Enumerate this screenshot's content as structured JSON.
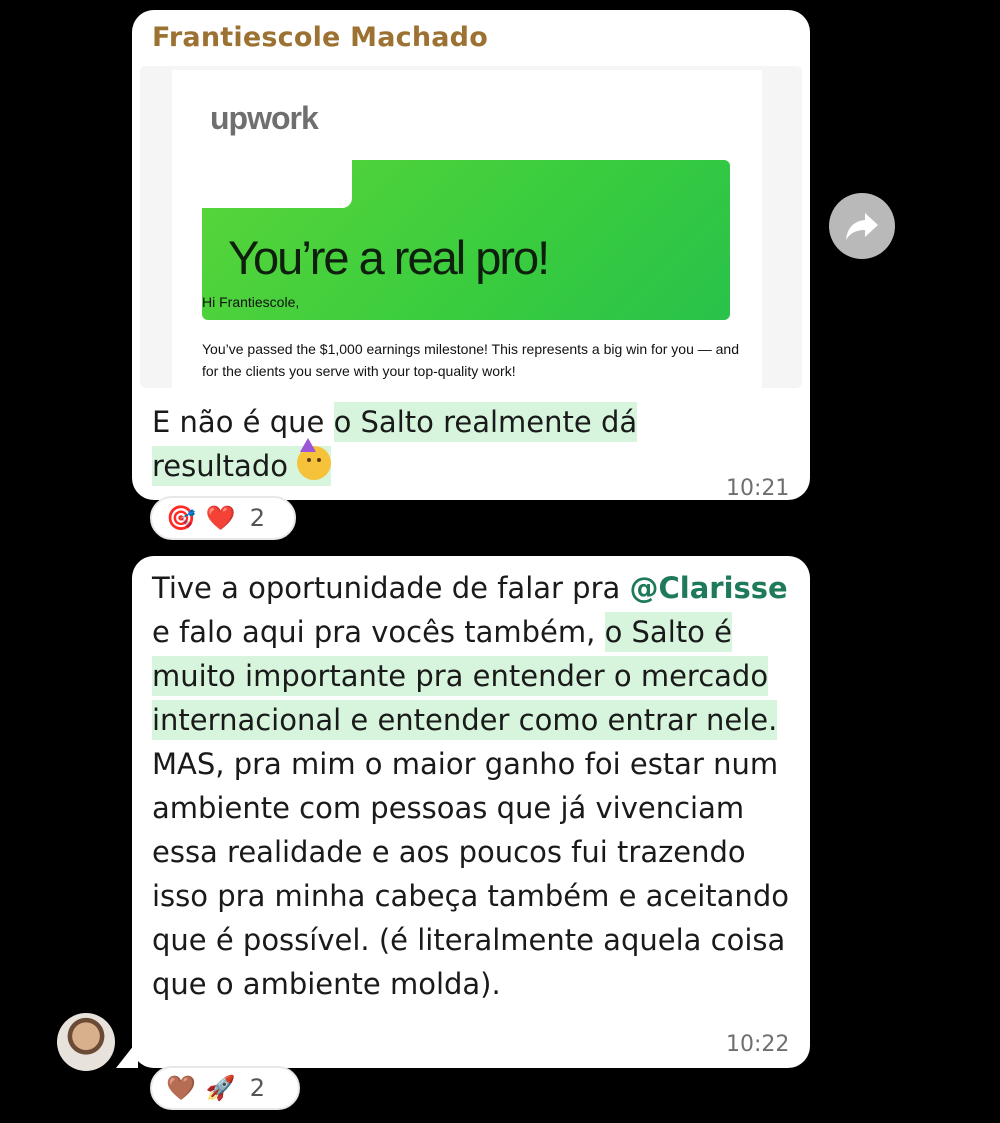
{
  "message1": {
    "sender": "Frantiescole Machado",
    "embed": {
      "logo_text": "upwork",
      "headline": "You’re a real pro!",
      "greeting": "Hi Frantiescole,",
      "body": "You’ve passed the $1,000 earnings milestone! This represents a big win for you — and for the clients you serve with your top-quality work!"
    },
    "text_plain": "E não é que ",
    "text_highlight_1": "o Salto realmente dá",
    "text_highlight_2": "resultado",
    "time": "10:21",
    "reactions": {
      "emoji_1": "🎯",
      "emoji_2": "❤️",
      "count": "2"
    }
  },
  "message2": {
    "line_start": "Tive a oportunidade de falar pra ",
    "mention": "@Clarisse",
    "after_mention": " e falo aqui pra vocês também,",
    "highlight": "o Salto é muito importante pra entender o mercado internacional e entender como entrar nele.",
    "rest": " MAS, pra mim o maior ganho foi estar num ambiente com pessoas que já vivenciam essa realidade e aos poucos fui trazendo isso pra minha cabeça também e aceitando que é possível. (é literalmente aquela coisa que o ambiente molda).",
    "time": "10:22",
    "reactions": {
      "emoji_1": "🤎",
      "emoji_2": "🚀",
      "count": "2"
    }
  },
  "icons": {
    "forward": "forward-arrow-icon",
    "avatar": "user-avatar"
  },
  "colors": {
    "sender": "#9c7232",
    "highlight": "#d7f5dd",
    "mention": "#1f7a5a",
    "background": "#000000"
  }
}
